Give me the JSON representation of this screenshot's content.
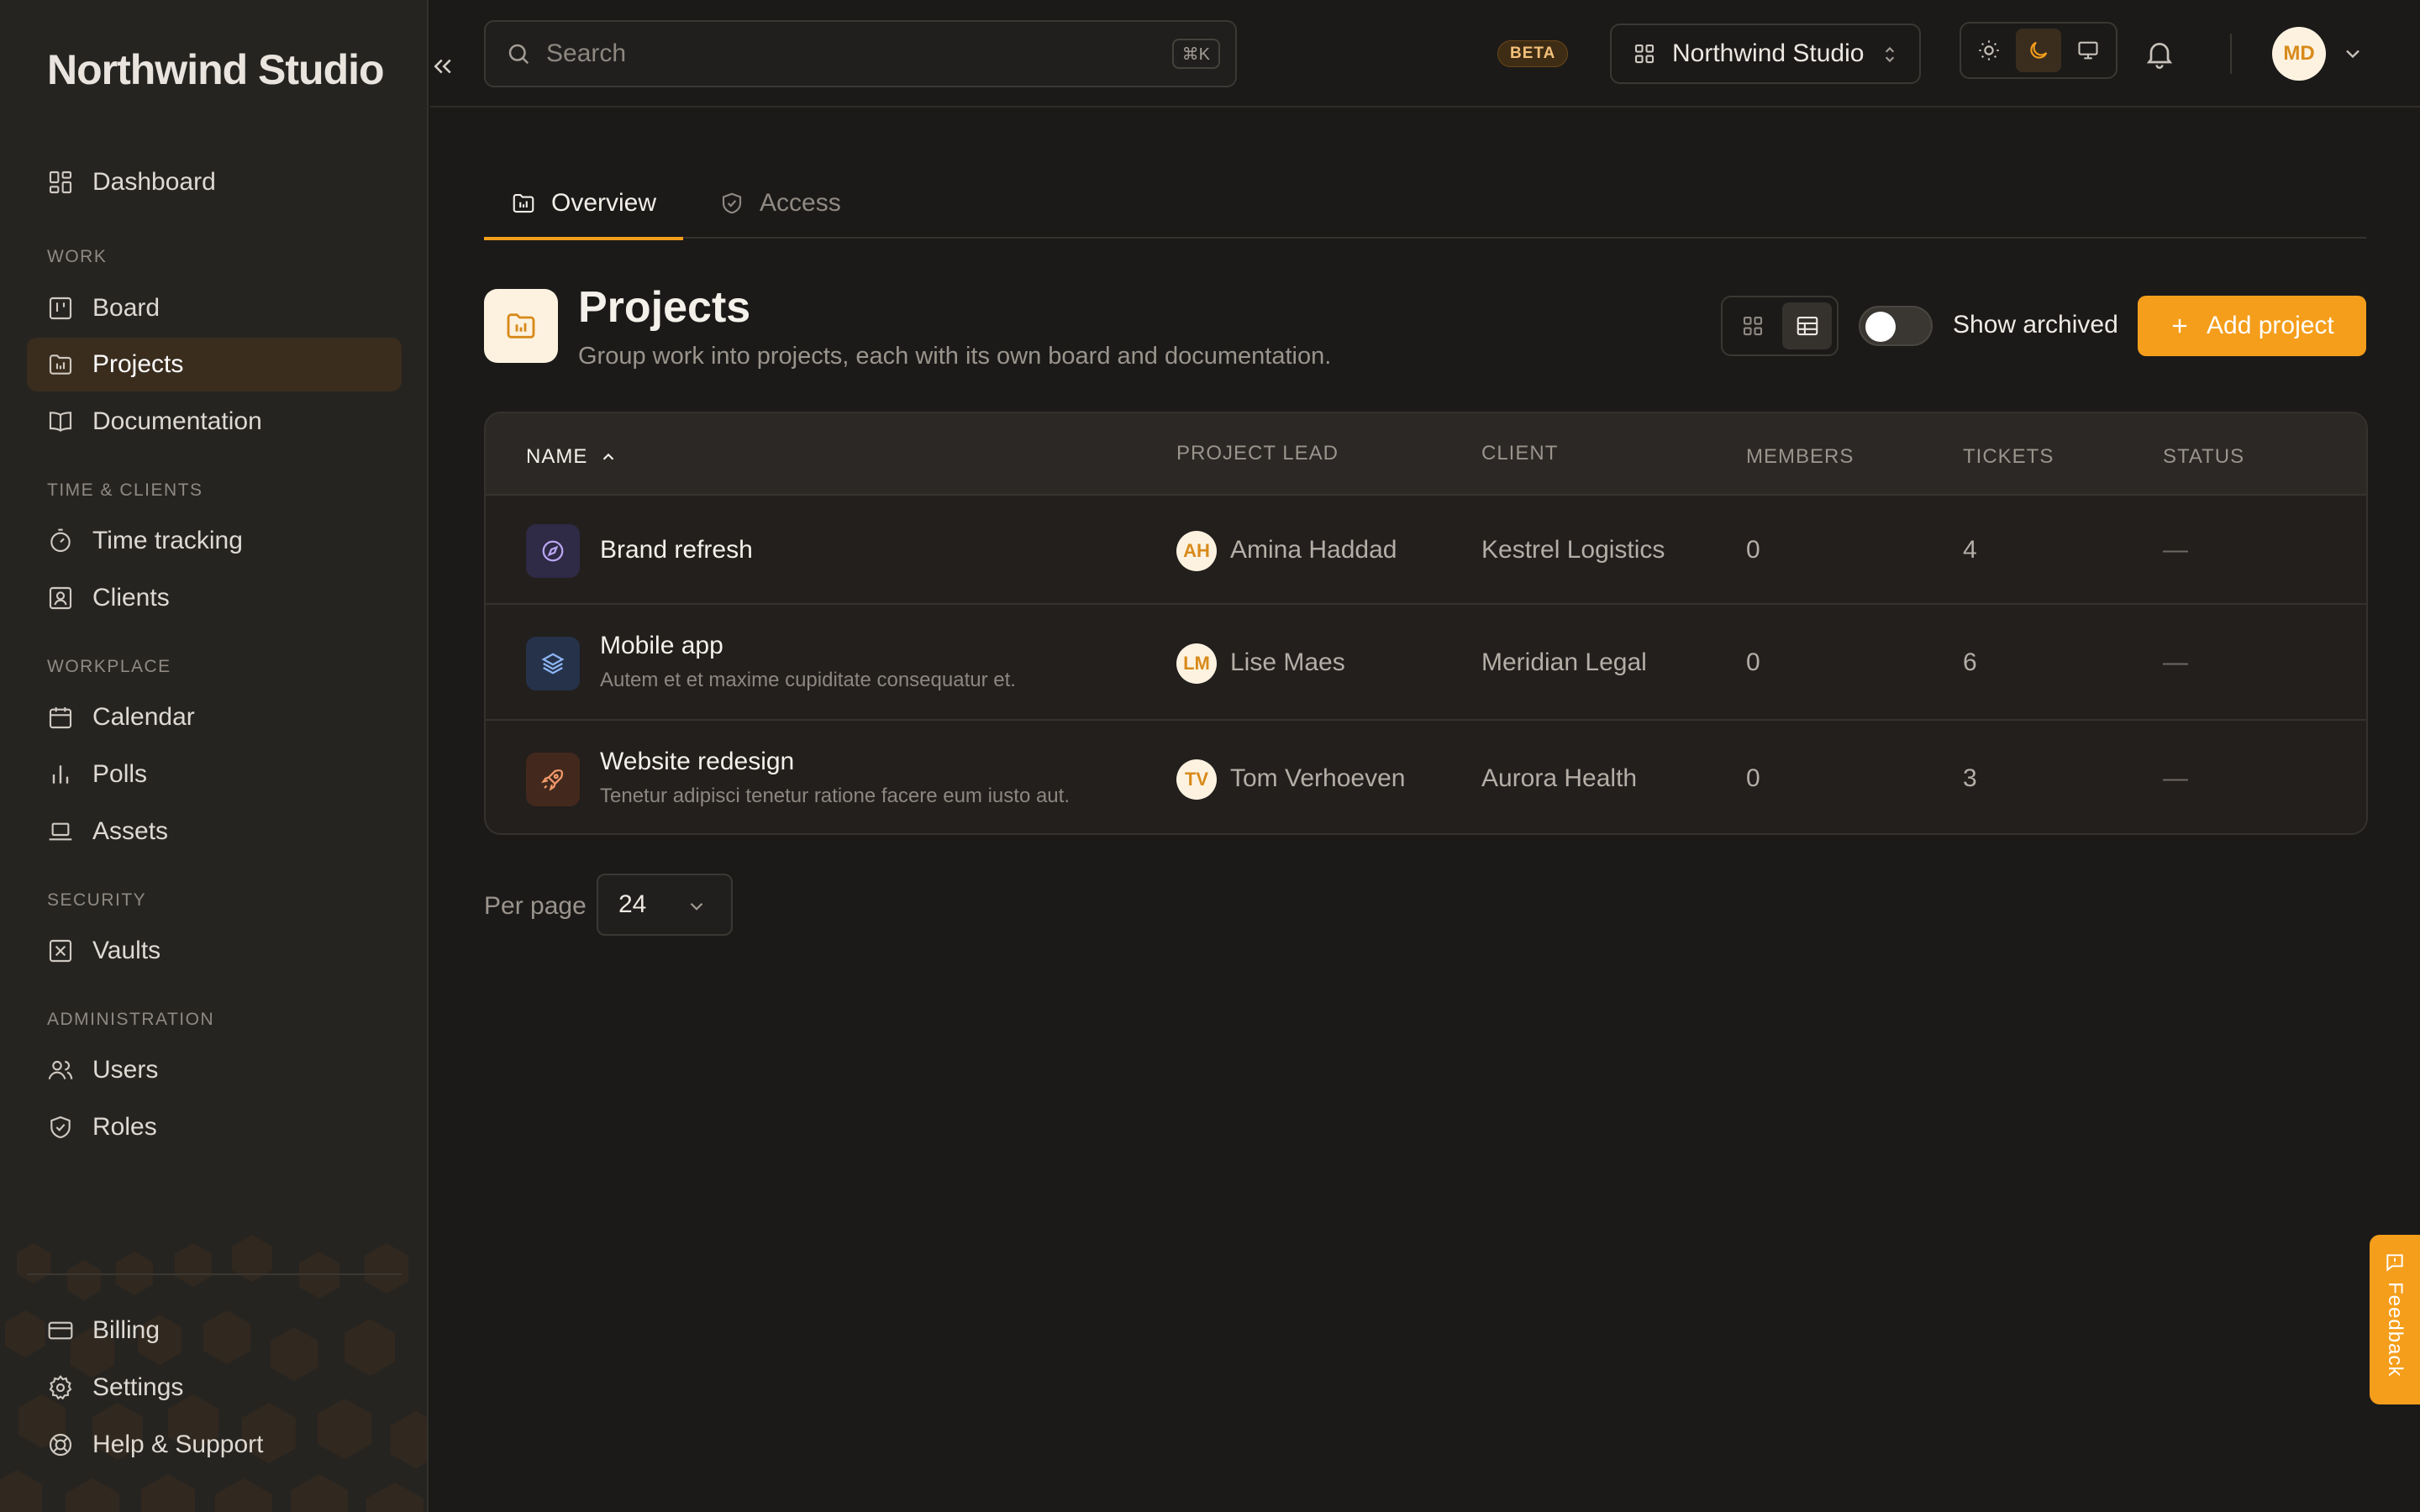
{
  "app": {
    "brand": "Northwind Studio",
    "accent_color": "#f59e1b"
  },
  "sidebar": {
    "primary": [
      {
        "label": "Dashboard",
        "icon": "dashboard-icon"
      }
    ],
    "sections": [
      {
        "title": "Work",
        "items": [
          {
            "label": "Board",
            "icon": "board-icon"
          },
          {
            "label": "Projects",
            "icon": "folder-chart-icon",
            "active": true
          },
          {
            "label": "Documentation",
            "icon": "book-icon"
          }
        ]
      },
      {
        "title": "Time & Clients",
        "items": [
          {
            "label": "Time tracking",
            "icon": "stopwatch-icon"
          },
          {
            "label": "Clients",
            "icon": "contact-icon"
          }
        ]
      },
      {
        "title": "Workplace",
        "items": [
          {
            "label": "Calendar",
            "icon": "calendar-icon"
          },
          {
            "label": "Polls",
            "icon": "bar-chart-icon"
          },
          {
            "label": "Assets",
            "icon": "laptop-icon"
          }
        ]
      },
      {
        "title": "Security",
        "items": [
          {
            "label": "Vaults",
            "icon": "vault-icon"
          }
        ]
      },
      {
        "title": "Administration",
        "items": [
          {
            "label": "Users",
            "icon": "users-icon"
          },
          {
            "label": "Roles",
            "icon": "shield-check-icon"
          }
        ]
      }
    ],
    "footer": [
      {
        "label": "Billing",
        "icon": "credit-card-icon"
      },
      {
        "label": "Settings",
        "icon": "gear-icon"
      },
      {
        "label": "Help & Support",
        "icon": "lifebuoy-icon"
      }
    ]
  },
  "topbar": {
    "search_placeholder": "Search",
    "search_shortcut": "⌘K",
    "beta_badge": "BETA",
    "workspace_name": "Northwind Studio",
    "theme_options": [
      "sun-icon",
      "moon-icon",
      "monitor-icon"
    ],
    "active_theme": "moon-icon",
    "user_initials": "MD"
  },
  "tabs": [
    {
      "label": "Overview",
      "icon": "folder-chart-icon",
      "active": true
    },
    {
      "label": "Access",
      "icon": "shield-check-icon",
      "active": false
    }
  ],
  "page": {
    "title": "Projects",
    "subtitle": "Group work into projects, each with its own board and documentation.",
    "show_archived_label": "Show archived",
    "show_archived": false,
    "add_button_label": "Add project",
    "view_mode": "table"
  },
  "table": {
    "columns": {
      "name": "Name",
      "lead": "Project lead",
      "client": "Client",
      "members": "Members",
      "tickets": "Tickets",
      "status": "Status"
    },
    "sort": {
      "column": "name",
      "direction": "asc"
    },
    "rows": [
      {
        "name": "Brand refresh",
        "description": "",
        "icon": "compass-icon",
        "icon_bg": "#2f2a45",
        "icon_color": "#b9a6f3",
        "lead_initials": "AH",
        "lead_name": "Amina Haddad",
        "client": "Kestrel Logistics",
        "members": "0",
        "tickets": "4",
        "status": "—"
      },
      {
        "name": "Mobile app",
        "description": "Autem et et maxime cupiditate consequatur et.",
        "icon": "layers-icon",
        "icon_bg": "#25324a",
        "icon_color": "#8fb5f5",
        "lead_initials": "LM",
        "lead_name": "Lise Maes",
        "client": "Meridian Legal",
        "members": "0",
        "tickets": "6",
        "status": "—"
      },
      {
        "name": "Website redesign",
        "description": "Tenetur adipisci tenetur ratione facere eum iusto aut.",
        "icon": "rocket-icon",
        "icon_bg": "#43291d",
        "icon_color": "#f29a6a",
        "lead_initials": "TV",
        "lead_name": "Tom Verhoeven",
        "client": "Aurora Health",
        "members": "0",
        "tickets": "3",
        "status": "—"
      }
    ]
  },
  "pagination": {
    "per_page_label": "Per page",
    "per_page_value": "24"
  },
  "feedback_label": "Feedback"
}
